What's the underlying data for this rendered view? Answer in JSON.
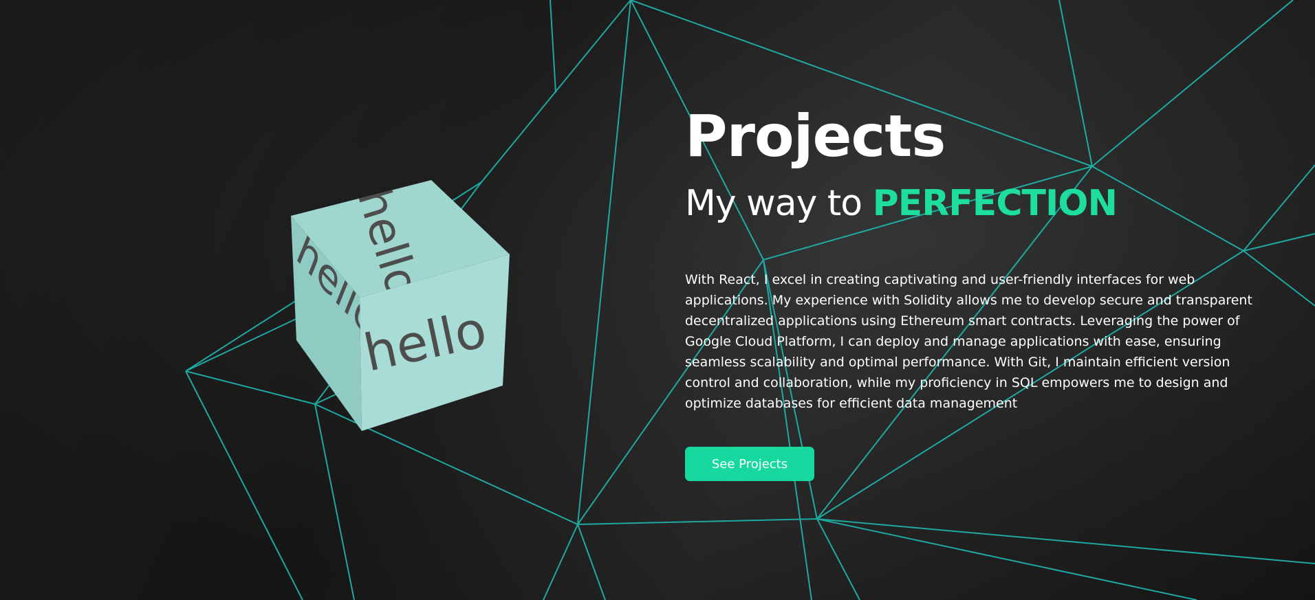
{
  "hero": {
    "title": "Projects",
    "subtitle_prefix": "My way to",
    "subtitle_accent": "PERFECTION",
    "description": "With React, I excel in creating captivating and user-friendly interfaces for web applications. My experience with Solidity allows me to develop secure and transparent decentralized applications using Ethereum smart contracts. Leveraging the power of Google Cloud Platform, I can deploy and manage applications with ease, ensuring seamless scalability and optimal performance. With Git, I maintain efficient version control and collaboration, while my proficiency in SQL empowers me to design and optimize databases for efficient data management",
    "button_label": "See Projects"
  },
  "cube": {
    "top_text": "hello",
    "left_text": "hello",
    "front_text": "hello"
  },
  "colors": {
    "accent": "#1ddd9f",
    "button": "#17d9a0",
    "wireframe": "#1fb8b0",
    "cube_face": "#a6dcd5"
  }
}
